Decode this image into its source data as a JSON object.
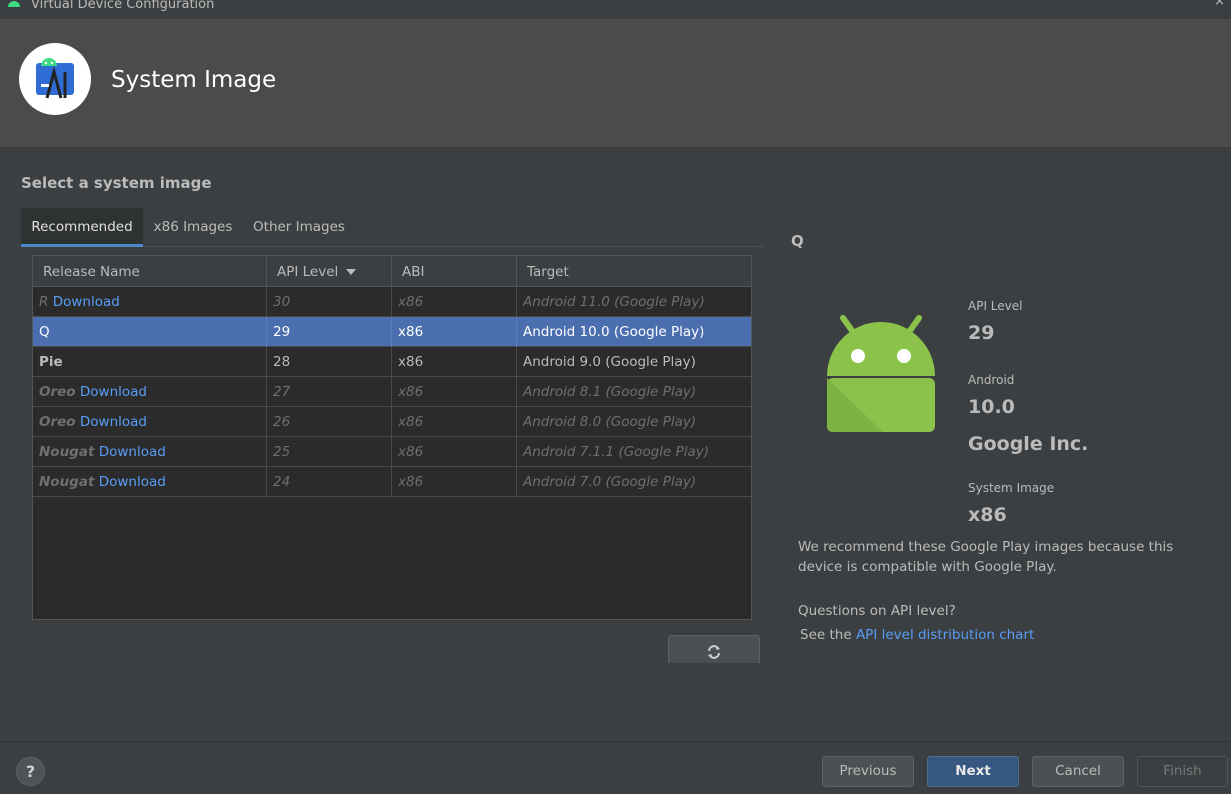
{
  "window": {
    "title": "Virtual Device Configuration",
    "close_glyph": "×"
  },
  "header": {
    "title": "System Image",
    "logo_icon": "android-studio-logo-icon"
  },
  "section_title": "Select a system image",
  "tabs": [
    {
      "label": "Recommended",
      "active": true
    },
    {
      "label": "x86 Images",
      "active": false
    },
    {
      "label": "Other Images",
      "active": false
    }
  ],
  "table": {
    "columns": [
      "Release Name",
      "API Level",
      "ABI",
      "Target"
    ],
    "sorted_column": "API Level",
    "rows": [
      {
        "name": "R",
        "download": "Download",
        "api": "30",
        "abi": "x86",
        "target": "Android 11.0 (Google Play)",
        "state": "download"
      },
      {
        "name": "Q",
        "download": "",
        "api": "29",
        "abi": "x86",
        "target": "Android 10.0 (Google Play)",
        "state": "selected"
      },
      {
        "name": "Pie",
        "download": "",
        "api": "28",
        "abi": "x86",
        "target": "Android 9.0 (Google Play)",
        "state": "installed"
      },
      {
        "name": "Oreo",
        "download": "Download",
        "api": "27",
        "abi": "x86",
        "target": "Android 8.1 (Google Play)",
        "state": "download"
      },
      {
        "name": "Oreo",
        "download": "Download",
        "api": "26",
        "abi": "x86",
        "target": "Android 8.0 (Google Play)",
        "state": "download"
      },
      {
        "name": "Nougat",
        "download": "Download",
        "api": "25",
        "abi": "x86",
        "target": "Android 7.1.1 (Google Play)",
        "state": "download"
      },
      {
        "name": "Nougat",
        "download": "Download",
        "api": "24",
        "abi": "x86",
        "target": "Android 7.0 (Google Play)",
        "state": "download"
      }
    ]
  },
  "refresh_icon": "refresh-icon",
  "details": {
    "name": "Q",
    "api_level_label": "API Level",
    "api_level_value": "29",
    "android_label": "Android",
    "android_value": "10.0",
    "vendor": "Google Inc.",
    "system_image_label": "System Image",
    "system_image_value": "x86",
    "recommend_text": "We recommend these Google Play images because this device is compatible with Google Play.",
    "question": "Questions on API level?",
    "see_the": "See the",
    "link_text": "API level distribution chart"
  },
  "footer": {
    "help": "?",
    "previous": "Previous",
    "next": "Next",
    "cancel": "Cancel",
    "finish": "Finish"
  },
  "colors": {
    "selection": "#4b6eaf",
    "link": "#589df6",
    "android_green": "#8bc34a"
  }
}
